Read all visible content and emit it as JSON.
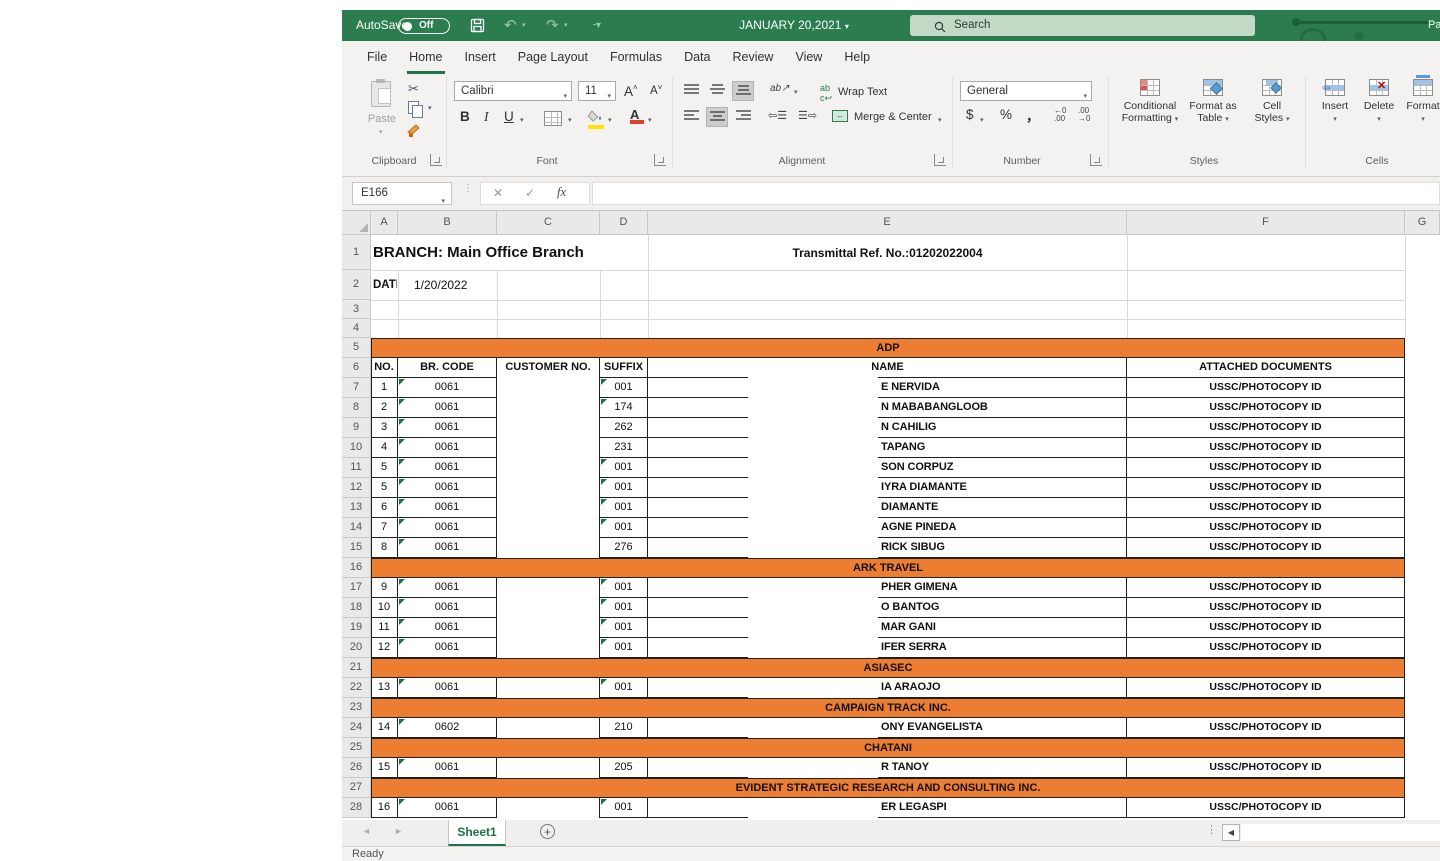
{
  "window": {
    "autosave_label": "AutoSave",
    "autosave_state": "Off",
    "title": "JANUARY 20,2021",
    "search_placeholder": "Search",
    "account_fragment": "Pa"
  },
  "ribbon": {
    "tabs": [
      {
        "label": "File",
        "active": false
      },
      {
        "label": "Home",
        "active": true
      },
      {
        "label": "Insert",
        "active": false
      },
      {
        "label": "Page Layout",
        "active": false
      },
      {
        "label": "Formulas",
        "active": false
      },
      {
        "label": "Data",
        "active": false
      },
      {
        "label": "Review",
        "active": false
      },
      {
        "label": "View",
        "active": false
      },
      {
        "label": "Help",
        "active": false
      }
    ],
    "clipboard": {
      "group": "Clipboard",
      "paste": "Paste"
    },
    "font": {
      "group": "Font",
      "font_name": "Calibri",
      "font_size": "11"
    },
    "alignment": {
      "group": "Alignment",
      "wrap_text": "Wrap Text",
      "merge_center": "Merge & Center"
    },
    "number": {
      "group": "Number",
      "format": "General"
    },
    "styles": {
      "group": "Styles",
      "buttons": [
        [
          "Conditional",
          "Formatting"
        ],
        [
          "Format as",
          "Table"
        ],
        [
          "Cell",
          "Styles"
        ]
      ]
    },
    "cells": {
      "group": "Cells",
      "buttons": [
        "Insert",
        "Delete",
        "Format"
      ]
    }
  },
  "formula_bar": {
    "name_box": "E166",
    "fx_label": "fx"
  },
  "sheet": {
    "columns": [
      "A",
      "B",
      "C",
      "D",
      "E",
      "F",
      "G"
    ],
    "branch_title": "BRANCH: Main Office Branch",
    "transmittal": "Transmittal Ref. No.:01202022004",
    "date_label": "DATE",
    "date_value": "1/20/2022",
    "headers": {
      "no": "NO.",
      "br_code": "BR. CODE",
      "customer": "CUSTOMER NO.",
      "suffix": "SUFFIX",
      "name": "NAME",
      "docs": "ATTACHED DOCUMENTS"
    },
    "rows": [
      {
        "t": "band",
        "label": "ADP"
      },
      {
        "t": "header"
      },
      {
        "t": "d",
        "no": "1",
        "br": "0061",
        "suf": "001",
        "name": "E NERVIDA",
        "doc": "USSC/PHOTOCOPY ID",
        "tri": true
      },
      {
        "t": "d",
        "no": "2",
        "br": "0061",
        "suf": "174",
        "name": "N MABABANGLOOB",
        "doc": "USSC/PHOTOCOPY ID",
        "tri": true
      },
      {
        "t": "d",
        "no": "3",
        "br": "0061",
        "suf": "262",
        "name": "N CAHILIG",
        "doc": "USSC/PHOTOCOPY ID",
        "tri": false
      },
      {
        "t": "d",
        "no": "4",
        "br": "0061",
        "suf": "231",
        "name": "TAPANG",
        "doc": "USSC/PHOTOCOPY ID",
        "tri": false
      },
      {
        "t": "d",
        "no": "5",
        "br": "0061",
        "suf": "001",
        "name": "SON CORPUZ",
        "doc": "USSC/PHOTOCOPY ID",
        "tri": true
      },
      {
        "t": "d",
        "no": "5",
        "br": "0061",
        "suf": "001",
        "name": "IYRA DIAMANTE",
        "doc": "USSC/PHOTOCOPY ID",
        "tri": true
      },
      {
        "t": "d",
        "no": "6",
        "br": "0061",
        "suf": "001",
        "name": "DIAMANTE",
        "doc": "USSC/PHOTOCOPY ID",
        "tri": true
      },
      {
        "t": "d",
        "no": "7",
        "br": "0061",
        "suf": "001",
        "name": "AGNE PINEDA",
        "doc": "USSC/PHOTOCOPY ID",
        "tri": true
      },
      {
        "t": "d",
        "no": "8",
        "br": "0061",
        "suf": "276",
        "name": "RICK SIBUG",
        "doc": "USSC/PHOTOCOPY ID",
        "tri": false
      },
      {
        "t": "band",
        "label": "ARK TRAVEL"
      },
      {
        "t": "d",
        "no": "9",
        "br": "0061",
        "suf": "001",
        "name": "PHER GIMENA",
        "doc": "USSC/PHOTOCOPY ID",
        "tri": true
      },
      {
        "t": "d",
        "no": "10",
        "br": "0061",
        "suf": "001",
        "name": "O BANTOG",
        "doc": "USSC/PHOTOCOPY ID",
        "tri": true
      },
      {
        "t": "d",
        "no": "11",
        "br": "0061",
        "suf": "001",
        "name": "MAR GANI",
        "doc": "USSC/PHOTOCOPY ID",
        "tri": true
      },
      {
        "t": "d",
        "no": "12",
        "br": "0061",
        "suf": "001",
        "name": "IFER SERRA",
        "doc": "USSC/PHOTOCOPY ID",
        "tri": true
      },
      {
        "t": "band",
        "label": "ASIASEC"
      },
      {
        "t": "d",
        "no": "13",
        "br": "0061",
        "suf": "001",
        "name": "IA ARAOJO",
        "doc": "USSC/PHOTOCOPY ID",
        "tri": true
      },
      {
        "t": "band",
        "label": "CAMPAIGN TRACK INC."
      },
      {
        "t": "d",
        "no": "14",
        "br": "0602",
        "suf": "210",
        "name": "ONY EVANGELISTA",
        "doc": "USSC/PHOTOCOPY ID",
        "tri": false
      },
      {
        "t": "band",
        "label": "CHATANI"
      },
      {
        "t": "d",
        "no": "15",
        "br": "0061",
        "suf": "205",
        "name": "R TANOY",
        "doc": "USSC/PHOTOCOPY ID",
        "tri": false
      },
      {
        "t": "band",
        "label": "EVIDENT STRATEGIC RESEARCH AND CONSULTING INC."
      },
      {
        "t": "d",
        "no": "16",
        "br": "0061",
        "suf": "001",
        "name": "ER LEGASPI",
        "doc": "USSC/PHOTOCOPY ID",
        "tri": true
      }
    ]
  },
  "tabbar": {
    "sheet_name": "Sheet1",
    "status": "Ready"
  }
}
